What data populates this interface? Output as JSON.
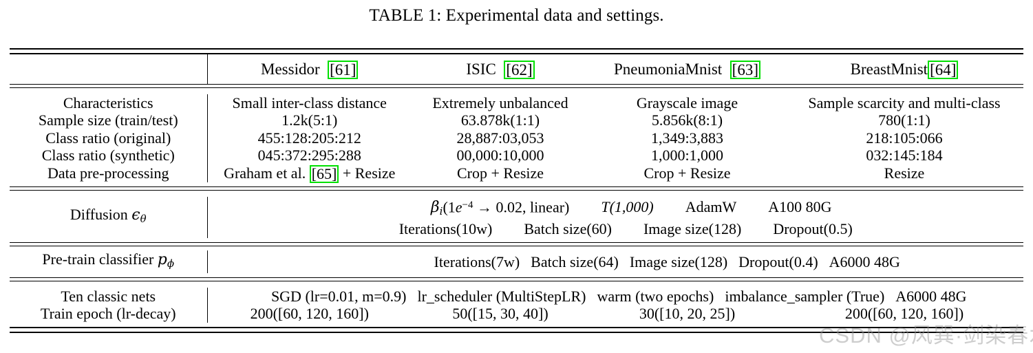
{
  "caption": "TABLE 1: Experimental data and settings.",
  "colors": {
    "citation_highlight": "#00e000",
    "text": "#000000",
    "rule": "#000000",
    "watermark": "#969696"
  },
  "table": {
    "columns": [
      {
        "key": "rowlabel",
        "label": ""
      },
      {
        "key": "messidor",
        "label": "Messidor",
        "citation": "[61]"
      },
      {
        "key": "isic",
        "label": "ISIC",
        "citation": "[62]"
      },
      {
        "key": "pneumoniamnist",
        "label": "PneumoniaMnist",
        "citation": "[63]"
      },
      {
        "key": "breastmnist",
        "label": "BreastMnist",
        "citation": "[64]",
        "no_space_before_citation": true
      }
    ],
    "dataset_block": {
      "rows": [
        {
          "label": "Characteristics",
          "values": [
            "Small inter-class distance",
            "Extremely unbalanced",
            "Grayscale image",
            "Sample scarcity and multi-class"
          ]
        },
        {
          "label": "Sample size (train/test)",
          "values": [
            "1.2k(5:1)",
            "63.878k(1:1)",
            "5.856k(8:1)",
            "780(1:1)"
          ]
        },
        {
          "label": "Class ratio (original)",
          "values": [
            "455:128:205:212",
            "28,887:03,053",
            "1,349:3,883",
            "218:105:066"
          ]
        },
        {
          "label": "Class ratio (synthetic)",
          "values": [
            "045:372:295:288",
            "00,000:10,000",
            "1,000:1,000",
            "032:145:184"
          ]
        },
        {
          "label": "Data pre-processing",
          "values_rich": [
            {
              "pre": "Graham et al. ",
              "citation": "[65]",
              "post": " + Resize"
            },
            {
              "pre": "Crop + Resize",
              "citation": "",
              "post": ""
            },
            {
              "pre": "Crop + Resize",
              "citation": "",
              "post": ""
            },
            {
              "pre": "Resize",
              "citation": "",
              "post": ""
            }
          ]
        }
      ]
    },
    "diffusion_block": {
      "label_text": "Diffusion",
      "label_math": "ϵθ",
      "line1": {
        "beta": "βi",
        "formula": "(1e−4 → 0.02, linear)",
        "T": "T(1,000)",
        "optimizer": "AdamW",
        "gpu": "A100 80G"
      },
      "line2": {
        "iterations": "Iterations(10w)",
        "batch_size": "Batch size(60)",
        "image_size": "Image size(128)",
        "dropout": "Dropout(0.5)"
      }
    },
    "pretrain_block": {
      "label_text": "Pre-train classifier",
      "label_math": "pϕ",
      "iterations": "Iterations(7w)",
      "batch_size": "Batch size(64)",
      "image_size": "Image size(128)",
      "dropout": "Dropout(0.4)",
      "gpu": "A6000 48G"
    },
    "nets_block": {
      "row1_label": "Ten classic nets",
      "row2_label": "Train epoch (lr-decay)",
      "row1": {
        "optimizer": "SGD (lr=0.01, m=0.9)",
        "scheduler": "lr_scheduler (MultiStepLR)",
        "warm": "warm (two epochs)",
        "sampler": "imbalance_sampler (True)",
        "gpu": "A6000 48G"
      },
      "row2": {
        "messidor": "200([60, 120, 160])",
        "isic": "50([15, 30, 40])",
        "pneumoniamnist": "30([10, 20, 25])",
        "breastmnist": "200([60, 120, 160])"
      }
    }
  },
  "watermark": "CSDN @风巽·剑染春水"
}
